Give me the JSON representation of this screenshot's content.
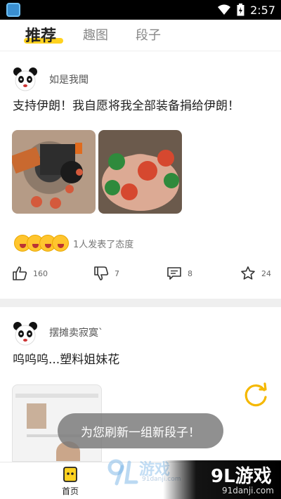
{
  "status_bar": {
    "time": "2:57"
  },
  "tabs": [
    {
      "label": "推荐",
      "active": true
    },
    {
      "label": "趣图",
      "active": false
    },
    {
      "label": "段子",
      "active": false
    }
  ],
  "posts": [
    {
      "username": "如是我聞",
      "text": "支持伊朗！我自愿将我全部装备捐给伊朗！",
      "reaction_text": "1人发表了态度",
      "likes": "160",
      "dislikes": "7",
      "comments": "8",
      "favorites": "24"
    },
    {
      "username": "摆摊卖寂寞`",
      "text": "呜呜呜...塑料姐妹花"
    }
  ],
  "toast": "为您刷新一组新段子！",
  "bottom_nav": {
    "home_label": "首页"
  },
  "watermarks": {
    "center_logo": "游戏",
    "center_url": "91danji.com",
    "right_logo": "9L游戏",
    "right_url": "91danji.com"
  },
  "colors": {
    "accent": "#ffd21f",
    "refresh": "#f5b800"
  }
}
